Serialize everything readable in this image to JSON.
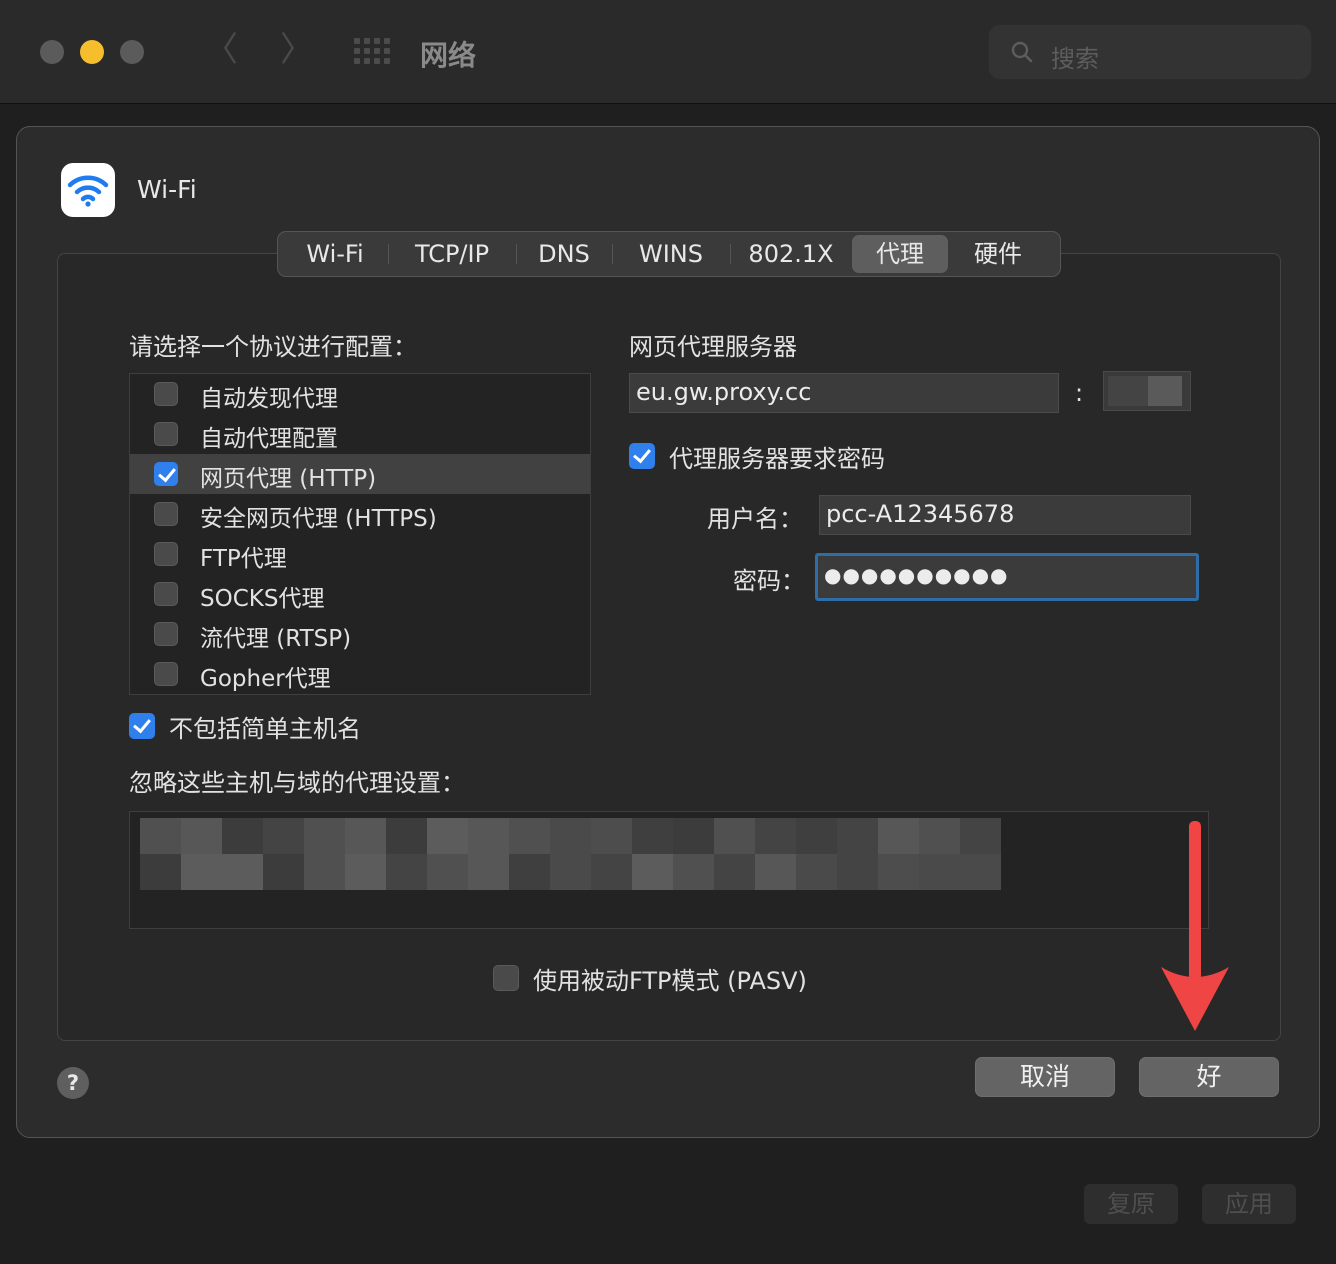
{
  "window": {
    "title": "网络",
    "search_placeholder": "搜索",
    "revert_label": "复原",
    "apply_label": "应用"
  },
  "interface": {
    "name": "Wi-Fi"
  },
  "tabs": [
    {
      "label": "Wi-Fi",
      "active": false
    },
    {
      "label": "TCP/IP",
      "active": false
    },
    {
      "label": "DNS",
      "active": false
    },
    {
      "label": "WINS",
      "active": false
    },
    {
      "label": "802.1X",
      "active": false
    },
    {
      "label": "代理",
      "active": true
    },
    {
      "label": "硬件",
      "active": false
    }
  ],
  "protocols": {
    "heading": "请选择一个协议进行配置：",
    "items": [
      {
        "label": "自动发现代理",
        "checked": false,
        "selected": false
      },
      {
        "label": "自动代理配置",
        "checked": false,
        "selected": false
      },
      {
        "label": "网页代理 (HTTP)",
        "checked": true,
        "selected": true
      },
      {
        "label": "安全网页代理 (HTTPS)",
        "checked": false,
        "selected": false
      },
      {
        "label": "FTP代理",
        "checked": false,
        "selected": false
      },
      {
        "label": "SOCKS代理",
        "checked": false,
        "selected": false
      },
      {
        "label": "流代理 (RTSP)",
        "checked": false,
        "selected": false
      },
      {
        "label": "Gopher代理",
        "checked": false,
        "selected": false
      }
    ]
  },
  "server": {
    "heading": "网页代理服务器",
    "host": "eu.gw.proxy.cc",
    "port_separator": ":",
    "requires_password_label": "代理服务器要求密码",
    "requires_password": true,
    "username_label": "用户名：",
    "username": "pcc-A12345678",
    "password_label": "密码：",
    "password_masked": "●●●●●●●●●●"
  },
  "exclude_simple": {
    "label": "不包括简单主机名",
    "checked": true
  },
  "bypass": {
    "label": "忽略这些主机与域的代理设置："
  },
  "pasv": {
    "label": "使用被动FTP模式 (PASV)",
    "checked": false
  },
  "buttons": {
    "help": "?",
    "cancel": "取消",
    "ok": "好"
  },
  "colors": {
    "accent": "#2f7fed",
    "focus_ring": "#2e6da8",
    "annotation_arrow": "#f04545",
    "traffic_yellow": "#f6bd2c"
  }
}
